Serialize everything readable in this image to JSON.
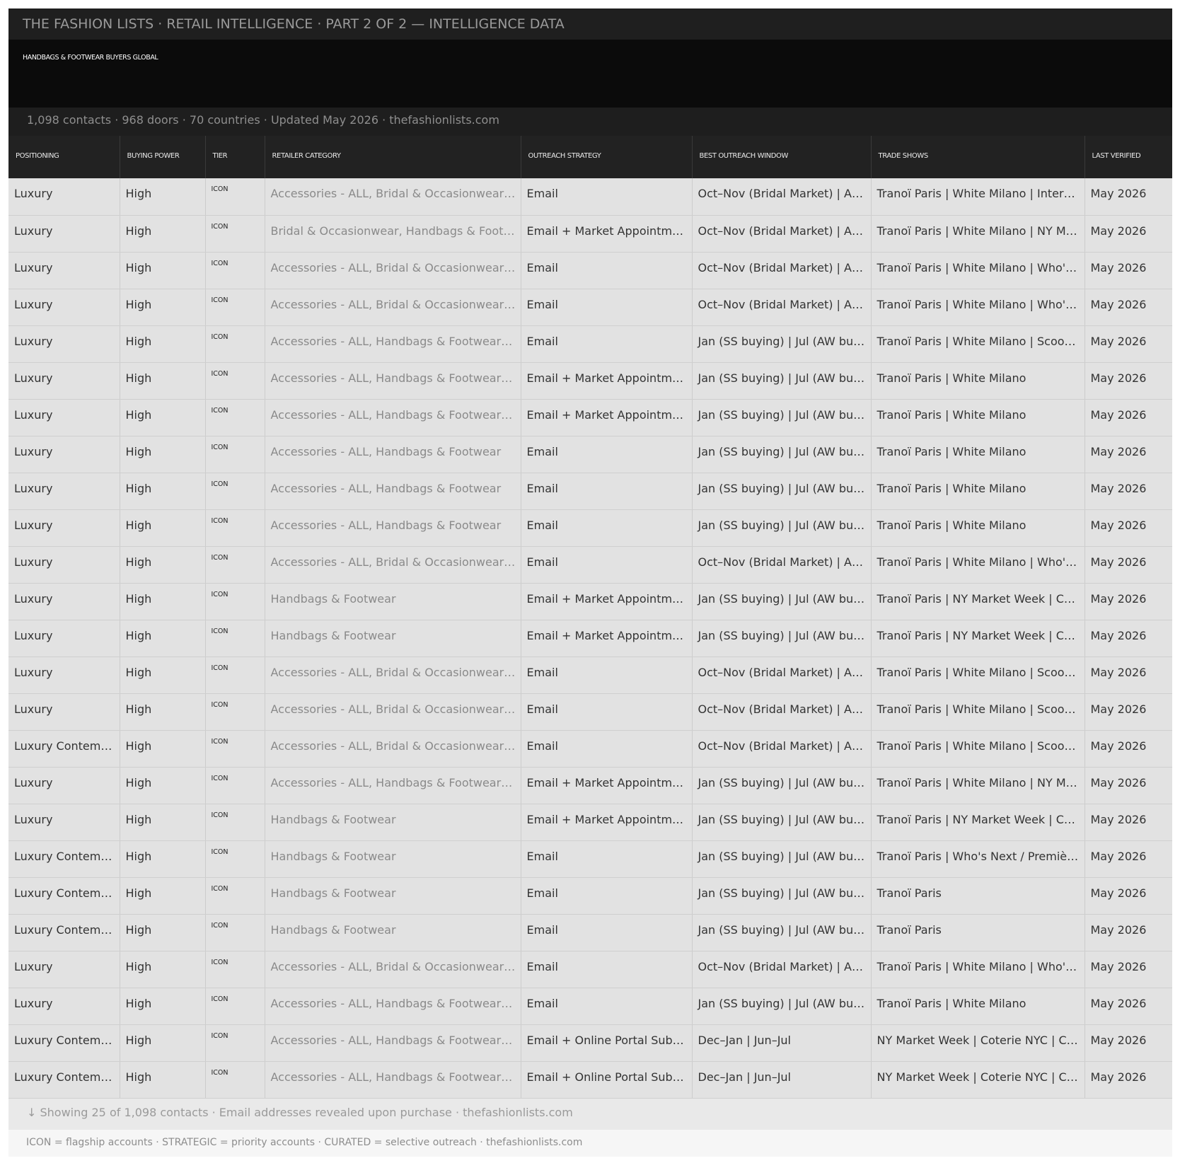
{
  "header": {
    "title": "THE FASHION LISTS  ·  RETAIL INTELLIGENCE  ·  PART 2 OF 2 — INTELLIGENCE DATA",
    "subtitle": "HANDBAGS & FOOTWEAR BUYERS GLOBAL",
    "stats": "1,098 contacts  ·  968 doors  ·  70 countries  ·  Updated May 2026  ·  thefashionlists.com"
  },
  "table": {
    "columns": [
      "POSITIONING",
      "BUYING POWER",
      "TIER",
      "RETAILER CATEGORY",
      "OUTREACH STRATEGY",
      "BEST OUTREACH WINDOW",
      "TRADE SHOWS",
      "LAST VERIFIED"
    ],
    "rows": [
      [
        "Luxury",
        "High",
        "ICON",
        "Accessories - ALL, Bridal & Occasionwear…",
        "Email",
        "Oct–Nov (Bridal Market) | A…",
        "Tranoï Paris | White Milano | Inter…",
        "May 2026"
      ],
      [
        "Luxury",
        "High",
        "ICON",
        "Bridal & Occasionwear, Handbags & Foot…",
        "Email + Market Appointm…",
        "Oct–Nov (Bridal Market) | A…",
        "Tranoï Paris | White Milano | NY M…",
        "May 2026"
      ],
      [
        "Luxury",
        "High",
        "ICON",
        "Accessories - ALL, Bridal & Occasionwear…",
        "Email",
        "Oct–Nov (Bridal Market) | A…",
        "Tranoï Paris | White Milano | Who'…",
        "May 2026"
      ],
      [
        "Luxury",
        "High",
        "ICON",
        "Accessories - ALL, Bridal & Occasionwear…",
        "Email",
        "Oct–Nov (Bridal Market) | A…",
        "Tranoï Paris | White Milano | Who'…",
        "May 2026"
      ],
      [
        "Luxury",
        "High",
        "ICON",
        "Accessories - ALL, Handbags & Footwear…",
        "Email",
        "Jan (SS buying) | Jul (AW bu…",
        "Tranoï Paris | White Milano | Scoo…",
        "May 2026"
      ],
      [
        "Luxury",
        "High",
        "ICON",
        "Accessories - ALL, Handbags & Footwear…",
        "Email + Market Appointm…",
        "Jan (SS buying) | Jul (AW bu…",
        "Tranoï Paris | White Milano",
        "May 2026"
      ],
      [
        "Luxury",
        "High",
        "ICON",
        "Accessories - ALL, Handbags & Footwear…",
        "Email + Market Appointm…",
        "Jan (SS buying) | Jul (AW bu…",
        "Tranoï Paris | White Milano",
        "May 2026"
      ],
      [
        "Luxury",
        "High",
        "ICON",
        "Accessories - ALL, Handbags & Footwear",
        "Email",
        "Jan (SS buying) | Jul (AW bu…",
        "Tranoï Paris | White Milano",
        "May 2026"
      ],
      [
        "Luxury",
        "High",
        "ICON",
        "Accessories - ALL, Handbags & Footwear",
        "Email",
        "Jan (SS buying) | Jul (AW bu…",
        "Tranoï Paris | White Milano",
        "May 2026"
      ],
      [
        "Luxury",
        "High",
        "ICON",
        "Accessories - ALL, Handbags & Footwear",
        "Email",
        "Jan (SS buying) | Jul (AW bu…",
        "Tranoï Paris | White Milano",
        "May 2026"
      ],
      [
        "Luxury",
        "High",
        "ICON",
        "Accessories - ALL, Bridal & Occasionwear…",
        "Email",
        "Oct–Nov (Bridal Market) | A…",
        "Tranoï Paris | White Milano | Who'…",
        "May 2026"
      ],
      [
        "Luxury",
        "High",
        "ICON",
        "Handbags & Footwear",
        "Email + Market Appointm…",
        "Jan (SS buying) | Jul (AW bu…",
        "Tranoï Paris | NY Market Week | C…",
        "May 2026"
      ],
      [
        "Luxury",
        "High",
        "ICON",
        "Handbags & Footwear",
        "Email + Market Appointm…",
        "Jan (SS buying) | Jul (AW bu…",
        "Tranoï Paris | NY Market Week | C…",
        "May 2026"
      ],
      [
        "Luxury",
        "High",
        "ICON",
        "Accessories - ALL, Bridal & Occasionwear…",
        "Email",
        "Oct–Nov (Bridal Market) | A…",
        "Tranoï Paris | White Milano | Scoo…",
        "May 2026"
      ],
      [
        "Luxury",
        "High",
        "ICON",
        "Accessories - ALL, Bridal & Occasionwear…",
        "Email",
        "Oct–Nov (Bridal Market) | A…",
        "Tranoï Paris | White Milano | Scoo…",
        "May 2026"
      ],
      [
        "Luxury Contem…",
        "High",
        "ICON",
        "Accessories - ALL, Bridal & Occasionwear…",
        "Email",
        "Oct–Nov (Bridal Market) | A…",
        "Tranoï Paris | White Milano | Scoo…",
        "May 2026"
      ],
      [
        "Luxury",
        "High",
        "ICON",
        "Accessories - ALL, Handbags & Footwear…",
        "Email + Market Appointm…",
        "Jan (SS buying) | Jul (AW bu…",
        "Tranoï Paris | White Milano | NY M…",
        "May 2026"
      ],
      [
        "Luxury",
        "High",
        "ICON",
        "Handbags & Footwear",
        "Email + Market Appointm…",
        "Jan (SS buying) | Jul (AW bu…",
        "Tranoï Paris | NY Market Week | C…",
        "May 2026"
      ],
      [
        "Luxury Contem…",
        "High",
        "ICON",
        "Handbags & Footwear",
        "Email",
        "Jan (SS buying) | Jul (AW bu…",
        "Tranoï Paris | Who's Next / Premiè…",
        "May 2026"
      ],
      [
        "Luxury Contem…",
        "High",
        "ICON",
        "Handbags & Footwear",
        "Email",
        "Jan (SS buying) | Jul (AW bu…",
        "Tranoï Paris",
        "May 2026"
      ],
      [
        "Luxury Contem…",
        "High",
        "ICON",
        "Handbags & Footwear",
        "Email",
        "Jan (SS buying) | Jul (AW bu…",
        "Tranoï Paris",
        "May 2026"
      ],
      [
        "Luxury",
        "High",
        "ICON",
        "Accessories - ALL, Bridal & Occasionwear…",
        "Email",
        "Oct–Nov (Bridal Market) | A…",
        "Tranoï Paris | White Milano | Who'…",
        "May 2026"
      ],
      [
        "Luxury",
        "High",
        "ICON",
        "Accessories - ALL, Handbags & Footwear…",
        "Email",
        "Jan (SS buying) | Jul (AW bu…",
        "Tranoï Paris | White Milano",
        "May 2026"
      ],
      [
        "Luxury Contem…",
        "High",
        "ICON",
        "Accessories - ALL, Handbags & Footwear…",
        "Email + Online Portal Sub…",
        "Dec–Jan | Jun–Jul",
        "NY Market Week | Coterie NYC | C…",
        "May 2026"
      ],
      [
        "Luxury Contem…",
        "High",
        "ICON",
        "Accessories - ALL, Handbags & Footwear…",
        "Email + Online Portal Sub…",
        "Dec–Jan | Jun–Jul",
        "NY Market Week | Coterie NYC | C…",
        "May 2026"
      ]
    ]
  },
  "footer": {
    "showing": "↓  Showing 25 of 1,098 contacts  ·  Email addresses revealed upon purchase  ·  thefashionlists.com",
    "legend": "ICON = flagship accounts  ·  STRATEGIC = priority accounts  ·  CURATED = selective outreach  ·  thefashionlists.com"
  }
}
